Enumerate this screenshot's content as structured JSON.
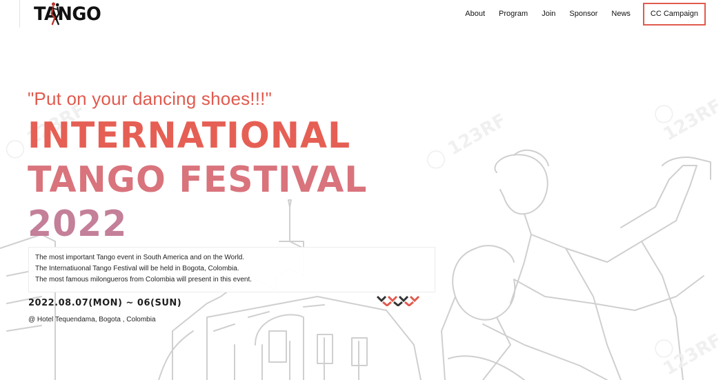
{
  "header": {
    "logo_text": "TANGO",
    "nav": [
      "About",
      "Program",
      "Join",
      "Sponsor",
      "News"
    ],
    "cta_label": "CC Campaign"
  },
  "hero": {
    "tagline": "\"Put on your dancing shoes!!!\"",
    "title_lines": [
      "INTERNATIONAL",
      "TANGO FESTIVAL",
      "2022"
    ],
    "description": [
      "The most important Tango event in South America and on the World.",
      "The Internatiuonal Tango Festival will be held in Bogota, Colombia.",
      "The most famous milongueros from Colombia will present in this event."
    ],
    "date": "2022.08.07(MON) ~ 06(SUN)",
    "venue": "@ Hotel Tequendama, Bogota , Colombia"
  },
  "colors": {
    "accent": "#e05a4e",
    "title_1": "#e65f54",
    "title_2": "#d9737c",
    "title_3": "#c47f99"
  },
  "icons": [
    "tango-dancers-logo-icon"
  ]
}
